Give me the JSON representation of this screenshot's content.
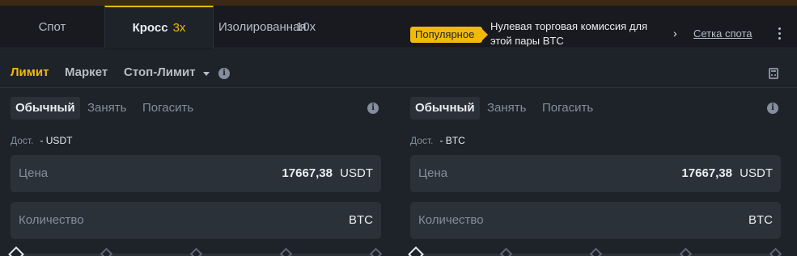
{
  "tabs": {
    "spot": "Спот",
    "cross": "Кросс",
    "cross_leverage": "3x",
    "isolated": "Изолированная",
    "isolated_leverage": "10x"
  },
  "promo": {
    "badge": "Популярное",
    "text": "Нулевая торговая комиссия для этой пары BTC",
    "arrow": "›",
    "link": "Сетка спота"
  },
  "order_types": {
    "limit": "Лимит",
    "market": "Маркет",
    "stop_limit": "Стоп-Лимит",
    "active": "limit"
  },
  "panels": {
    "buy": {
      "modes": {
        "normal": "Обычный",
        "borrow": "Занять",
        "repay": "Погасить"
      },
      "available_label": "Дост.",
      "available_value": "- USDT",
      "price_label": "Цена",
      "price_value": "17667,38",
      "price_unit": "USDT",
      "qty_label": "Количество",
      "qty_unit": "BTC"
    },
    "sell": {
      "modes": {
        "normal": "Обычный",
        "borrow": "Занять",
        "repay": "Погасить"
      },
      "available_label": "Дост.",
      "available_value": "- BTC",
      "price_label": "Цена",
      "price_value": "17667,38",
      "price_unit": "USDT",
      "qty_label": "Количество",
      "qty_unit": "BTC"
    }
  },
  "colors": {
    "accent": "#f0b90b",
    "background": "#181a20",
    "panel": "#1e2329",
    "field": "#2b3139",
    "text_primary": "#eaecef",
    "text_secondary": "#848e9c"
  },
  "icons": [
    "info-icon",
    "caret-down-icon",
    "calculator-icon",
    "more-vertical-icon",
    "chevron-right-icon",
    "slider-diamond-icon"
  ]
}
